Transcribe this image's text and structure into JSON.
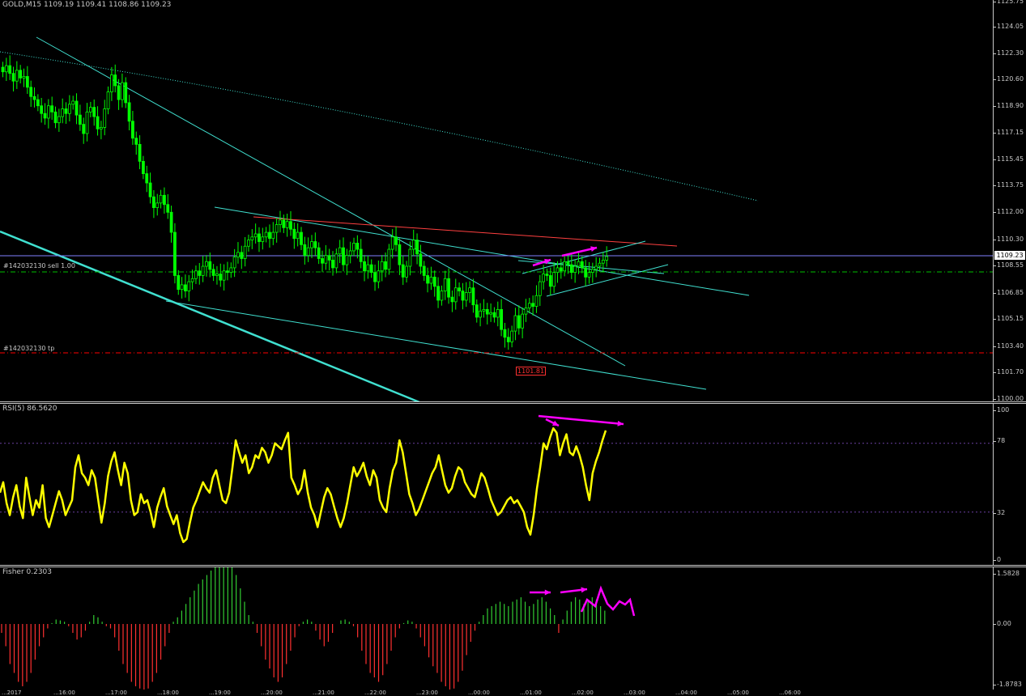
{
  "main": {
    "title": "GOLD,M15  1109.19 1109.41 1108.86 1109.23",
    "ticks": [
      "1125.75",
      "1124.05",
      "1122.30",
      "1120.60",
      "1118.90",
      "1117.15",
      "1115.45",
      "1113.75",
      "1112.00",
      "1110.30",
      "1108.55",
      "1106.85",
      "1105.15",
      "1103.40",
      "1101.70",
      "1100.00"
    ],
    "current_price": "1109.23",
    "order_label": "#142032130 sell 1.00",
    "tp_label": "#142032130 tp",
    "low_label": "1101.81",
    "colors": {
      "bull": "#00ff00",
      "bear": "#00ff00",
      "trend": "#40e0d0",
      "resistance": "#ff4040",
      "arrow": "#ff00ff",
      "ma": "#40e0d0",
      "order": "#00c000",
      "tp": "#ff0000"
    },
    "candles_close": [
      1121.2,
      1121.6,
      1121.1,
      1120.6,
      1121.3,
      1120.8,
      1120.9,
      1120.2,
      1119.6,
      1119.4,
      1119.0,
      1118.5,
      1118.2,
      1119.0,
      1118.6,
      1117.9,
      1118.3,
      1118.8,
      1118.5,
      1119.1,
      1119.3,
      1118.4,
      1117.8,
      1117.2,
      1118.6,
      1118.9,
      1118.3,
      1117.5,
      1117.6,
      1118.8,
      1119.9,
      1121.0,
      1120.3,
      1119.4,
      1120.5,
      1119.2,
      1118.0,
      1116.9,
      1116.5,
      1115.4,
      1114.6,
      1114.0,
      1113.1,
      1112.4,
      1112.7,
      1113.2,
      1112.6,
      1112.1,
      1110.8,
      1108.0,
      1107.1,
      1107.4,
      1107.0,
      1107.6,
      1107.8,
      1108.3,
      1108.0,
      1108.6,
      1108.9,
      1108.4,
      1108.0,
      1108.1,
      1107.7,
      1108.3,
      1108.2,
      1108.5,
      1109.2,
      1109.5,
      1109.1,
      1109.9,
      1110.3,
      1110.5,
      1110.7,
      1110.2,
      1110.5,
      1110.8,
      1110.4,
      1110.8,
      1111.3,
      1111.6,
      1111.1,
      1111.5,
      1111.0,
      1110.4,
      1110.8,
      1110.0,
      1109.3,
      1109.8,
      1110.2,
      1109.8,
      1109.1,
      1108.8,
      1109.3,
      1109.0,
      1108.5,
      1109.4,
      1109.8,
      1108.7,
      1109.3,
      1109.6,
      1110.1,
      1109.7,
      1108.9,
      1108.3,
      1108.7,
      1108.2,
      1107.6,
      1108.3,
      1108.9,
      1108.4,
      1109.7,
      1110.5,
      1110.0,
      1108.7,
      1107.9,
      1108.6,
      1109.7,
      1110.3,
      1109.4,
      1108.6,
      1108.0,
      1107.5,
      1107.9,
      1107.3,
      1106.4,
      1107.0,
      1107.8,
      1106.6,
      1106.3,
      1107.2,
      1107.0,
      1106.4,
      1106.9,
      1107.2,
      1106.1,
      1105.3,
      1105.7,
      1105.8,
      1105.5,
      1105.6,
      1105.3,
      1105.8,
      1104.5,
      1104.0,
      1103.7,
      1104.4,
      1105.4,
      1104.6,
      1105.5,
      1105.9,
      1106.2,
      1106.0,
      1106.7,
      1107.6,
      1108.1,
      1108.0,
      1107.3,
      1108.2,
      1108.5,
      1108.3,
      1108.9,
      1108.7,
      1108.2,
      1108.6,
      1108.9,
      1108.5,
      1107.9,
      1108.2,
      1108.4,
      1108.6,
      1108.8,
      1109.0,
      1109.23
    ]
  },
  "rsi": {
    "title": "RSI(5) 86.5620",
    "ticks": [
      "100",
      "78",
      "32",
      "0"
    ],
    "levels": [
      78,
      32
    ],
    "color": "#ffff00",
    "values": [
      45,
      52,
      38,
      30,
      42,
      50,
      36,
      28,
      55,
      42,
      30,
      40,
      35,
      50,
      28,
      22,
      30,
      38,
      46,
      40,
      30,
      35,
      40,
      62,
      70,
      58,
      55,
      50,
      60,
      55,
      40,
      25,
      38,
      56,
      66,
      72,
      60,
      50,
      65,
      58,
      40,
      30,
      32,
      44,
      38,
      40,
      32,
      22,
      35,
      42,
      48,
      36,
      30,
      24,
      30,
      18,
      12,
      14,
      25,
      35,
      40,
      46,
      52,
      48,
      45,
      55,
      60,
      50,
      40,
      38,
      45,
      62,
      80,
      72,
      65,
      70,
      58,
      62,
      70,
      68,
      75,
      72,
      65,
      70,
      78,
      76,
      74,
      80,
      85,
      55,
      50,
      44,
      48,
      60,
      45,
      35,
      30,
      22,
      32,
      42,
      48,
      44,
      36,
      28,
      22,
      28,
      38,
      50,
      62,
      56,
      60,
      65,
      56,
      50,
      60,
      55,
      40,
      35,
      32,
      48,
      60,
      65,
      80,
      72,
      58,
      44,
      38,
      30,
      34,
      40,
      46,
      52,
      58,
      62,
      70,
      60,
      50,
      45,
      48,
      56,
      62,
      60,
      52,
      48,
      44,
      42,
      50,
      58,
      55,
      48,
      40,
      35,
      30,
      32,
      36,
      40,
      42,
      38,
      40,
      36,
      32,
      22,
      17,
      30,
      48,
      62,
      78,
      74,
      82,
      88,
      85,
      70,
      78,
      84,
      72,
      70,
      76,
      70,
      62,
      50,
      40,
      58,
      66,
      72,
      80,
      86.562
    ]
  },
  "fisher": {
    "title": "Fisher 0.2303",
    "ticks": [
      "1.5828",
      "0.00",
      "-1.8783"
    ],
    "colors": {
      "pos": "#32cd32",
      "neg": "#ff3030"
    },
    "values": [
      -0.2,
      -0.5,
      -0.9,
      -1.1,
      -1.3,
      -1.4,
      -1.3,
      -1.1,
      -0.8,
      -0.5,
      -0.3,
      -0.1,
      0.02,
      0.1,
      0.08,
      0.05,
      -0.05,
      -0.2,
      -0.35,
      -0.3,
      -0.15,
      0.05,
      0.2,
      0.15,
      0.05,
      -0.05,
      -0.1,
      -0.3,
      -0.6,
      -0.9,
      -1.1,
      -1.3,
      -1.4,
      -1.45,
      -1.5,
      -1.45,
      -1.3,
      -1.1,
      -0.8,
      -0.5,
      -0.2,
      0.05,
      0.15,
      0.3,
      0.45,
      0.6,
      0.75,
      0.9,
      1.0,
      1.1,
      1.2,
      1.3,
      1.45,
      1.5,
      1.45,
      1.3,
      1.1,
      0.8,
      0.5,
      0.2,
      0.05,
      -0.2,
      -0.5,
      -0.8,
      -1.0,
      -1.2,
      -1.3,
      -1.2,
      -0.9,
      -0.6,
      -0.3,
      -0.05,
      0.05,
      0.1,
      0.05,
      -0.15,
      -0.35,
      -0.5,
      -0.4,
      -0.2,
      0.0,
      0.08,
      0.1,
      0.05,
      -0.05,
      -0.3,
      -0.6,
      -0.9,
      -1.1,
      -1.2,
      -1.3,
      -1.15,
      -0.9,
      -0.6,
      -0.3,
      -0.1,
      0.02,
      0.08,
      0.05,
      -0.1,
      -0.3,
      -0.5,
      -0.75,
      -0.95,
      -1.1,
      -1.3,
      -1.4,
      -1.5,
      -1.45,
      -1.3,
      -1.05,
      -0.7,
      -0.4,
      -0.15,
      0.05,
      0.2,
      0.35,
      0.4,
      0.45,
      0.5,
      0.45,
      0.4,
      0.5,
      0.55,
      0.6,
      0.5,
      0.4,
      0.45,
      0.55,
      0.6,
      0.5,
      0.35,
      0.2,
      -0.2,
      0.1,
      0.3,
      0.5,
      0.6,
      0.55,
      0.45,
      0.5,
      0.6,
      0.55,
      0.4,
      0.3
    ]
  },
  "xaxis": {
    "labels": [
      "...2017",
      "...16:00",
      "...17:00",
      "...18:00",
      "...19:00",
      "...20:00",
      "...21:00",
      "...22:00",
      "...23:00",
      "...00:00",
      "...01:00",
      "...02:00",
      "...03:00",
      "...04:00",
      "...05:00",
      "...06:00"
    ]
  }
}
